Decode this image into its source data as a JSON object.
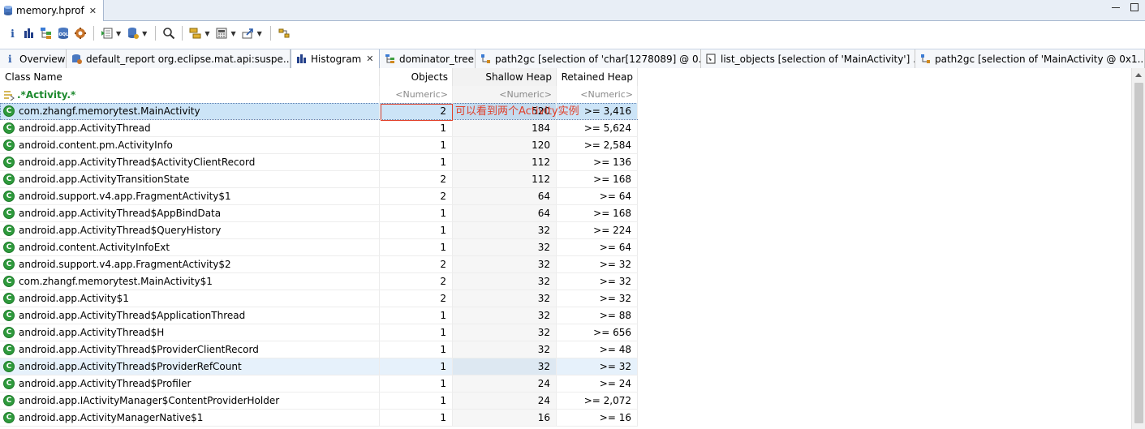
{
  "editor": {
    "file_tab": "memory.hprof",
    "close_glyph": "✕"
  },
  "toolbar": {
    "buttons": [
      "info-icon",
      "histogram-icon",
      "dominator-tree-icon",
      "oql-icon",
      "heap-dump-overview-icon",
      "run-report-icon",
      "query-browser-icon",
      "search-icon",
      "group-by-icon",
      "calculate-retained-icon",
      "export-icon",
      "pin-icon"
    ]
  },
  "view_tabs": [
    {
      "label": "Overview",
      "icon": "info-icon"
    },
    {
      "label": "default_report  org.eclipse.mat.api:suspe...",
      "icon": "report-icon"
    },
    {
      "label": "Histogram",
      "icon": "histogram-icon",
      "active": true
    },
    {
      "label": "dominator_tree",
      "icon": "dominator-tree-icon"
    },
    {
      "label": "path2gc [selection of 'char[1278089] @ 0...",
      "icon": "path-icon"
    },
    {
      "label": "list_objects [selection of 'MainActivity'] ...",
      "icon": "list-objects-icon"
    },
    {
      "label": "path2gc [selection of 'MainActivity @ 0x1...",
      "icon": "path-icon"
    }
  ],
  "table": {
    "columns": {
      "class_name": "Class Name",
      "objects": "Objects",
      "shallow_heap": "Shallow Heap",
      "retained_heap": "Retained Heap"
    },
    "filter": {
      "class_name": ".*Activity.*",
      "objects": "<Numeric>",
      "shallow_heap": "<Numeric>",
      "retained_heap": "<Numeric>"
    },
    "rows": [
      {
        "name": "com.zhangf.memorytest.MainActivity",
        "objects": "2",
        "shallow": "520",
        "retained": ">= 3,416"
      },
      {
        "name": "android.app.ActivityThread",
        "objects": "1",
        "shallow": "184",
        "retained": ">= 5,624"
      },
      {
        "name": "android.content.pm.ActivityInfo",
        "objects": "1",
        "shallow": "120",
        "retained": ">= 2,584"
      },
      {
        "name": "android.app.ActivityThread$ActivityClientRecord",
        "objects": "1",
        "shallow": "112",
        "retained": ">= 136"
      },
      {
        "name": "android.app.ActivityTransitionState",
        "objects": "2",
        "shallow": "112",
        "retained": ">= 168"
      },
      {
        "name": "android.support.v4.app.FragmentActivity$1",
        "objects": "2",
        "shallow": "64",
        "retained": ">= 64"
      },
      {
        "name": "android.app.ActivityThread$AppBindData",
        "objects": "1",
        "shallow": "64",
        "retained": ">= 168"
      },
      {
        "name": "android.app.ActivityThread$QueryHistory",
        "objects": "1",
        "shallow": "32",
        "retained": ">= 224"
      },
      {
        "name": "android.content.ActivityInfoExt",
        "objects": "1",
        "shallow": "32",
        "retained": ">= 64"
      },
      {
        "name": "android.support.v4.app.FragmentActivity$2",
        "objects": "2",
        "shallow": "32",
        "retained": ">= 32"
      },
      {
        "name": "com.zhangf.memorytest.MainActivity$1",
        "objects": "2",
        "shallow": "32",
        "retained": ">= 32"
      },
      {
        "name": "android.app.Activity$1",
        "objects": "2",
        "shallow": "32",
        "retained": ">= 32"
      },
      {
        "name": "android.app.ActivityThread$ApplicationThread",
        "objects": "1",
        "shallow": "32",
        "retained": ">= 88"
      },
      {
        "name": "android.app.ActivityThread$H",
        "objects": "1",
        "shallow": "32",
        "retained": ">= 656"
      },
      {
        "name": "android.app.ActivityThread$ProviderClientRecord",
        "objects": "1",
        "shallow": "32",
        "retained": ">= 48"
      },
      {
        "name": "android.app.ActivityThread$ProviderRefCount",
        "objects": "1",
        "shallow": "32",
        "retained": ">= 32"
      },
      {
        "name": "android.app.ActivityThread$Profiler",
        "objects": "1",
        "shallow": "24",
        "retained": ">= 24"
      },
      {
        "name": "android.app.IActivityManager$ContentProviderHolder",
        "objects": "1",
        "shallow": "24",
        "retained": ">= 2,072"
      },
      {
        "name": "android.app.ActivityManagerNative$1",
        "objects": "1",
        "shallow": "16",
        "retained": ">= 16"
      }
    ],
    "class_icon_letter": "C"
  },
  "annotation": {
    "text": "可以看到两个Activity实例"
  },
  "colors": {
    "annotation": "#e0402a",
    "filter_text": "#1d8a2e",
    "class_icon": "#2e9a3c",
    "selection": "#cce4f7"
  }
}
